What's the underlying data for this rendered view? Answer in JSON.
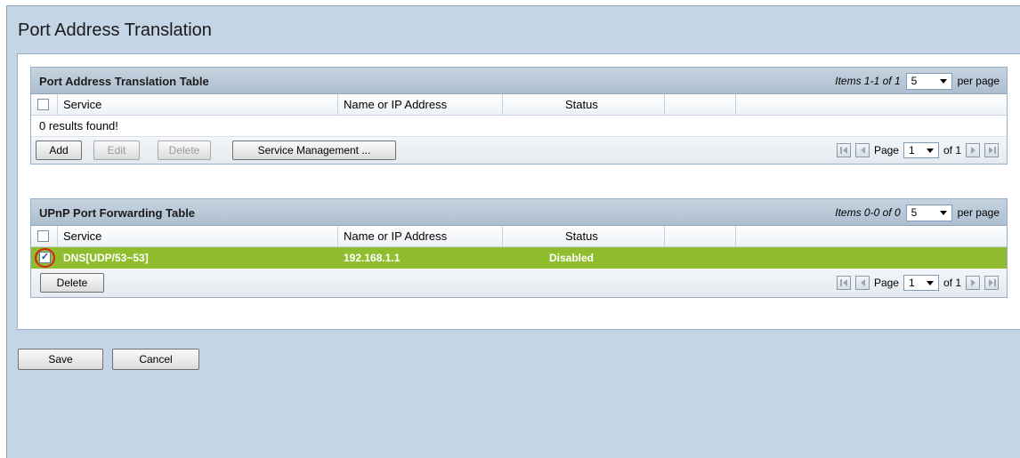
{
  "page": {
    "title": "Port Address Translation"
  },
  "pat_table": {
    "title": "Port Address Translation Table",
    "items_text": "Items 1-1 of 1",
    "per_page_value": "5",
    "per_page_label": "per page",
    "columns": [
      "Service",
      "Name or IP Address",
      "Status"
    ],
    "empty_message": "0 results found!",
    "buttons": {
      "add": "Add",
      "edit": "Edit",
      "delete": "Delete",
      "service_management": "Service Management ..."
    },
    "pager": {
      "page_label": "Page",
      "page_value": "1",
      "of_label": "of 1"
    }
  },
  "upnp_table": {
    "title": "UPnP Port Forwarding Table",
    "items_text": "Items 0-0 of 0",
    "per_page_value": "5",
    "per_page_label": "per page",
    "columns": [
      "Service",
      "Name or IP Address",
      "Status"
    ],
    "rows": [
      {
        "service": "DNS[UDP/53~53]",
        "address": "192.168.1.1",
        "status": "Disabled",
        "checked": true
      }
    ],
    "buttons": {
      "delete": "Delete"
    },
    "pager": {
      "page_label": "Page",
      "page_value": "1",
      "of_label": "of 1"
    }
  },
  "footer": {
    "save": "Save",
    "cancel": "Cancel"
  },
  "colors": {
    "selected_row": "#8fbd2e",
    "frame_bg": "#c4d5e6",
    "highlight_ring": "#d82020"
  }
}
